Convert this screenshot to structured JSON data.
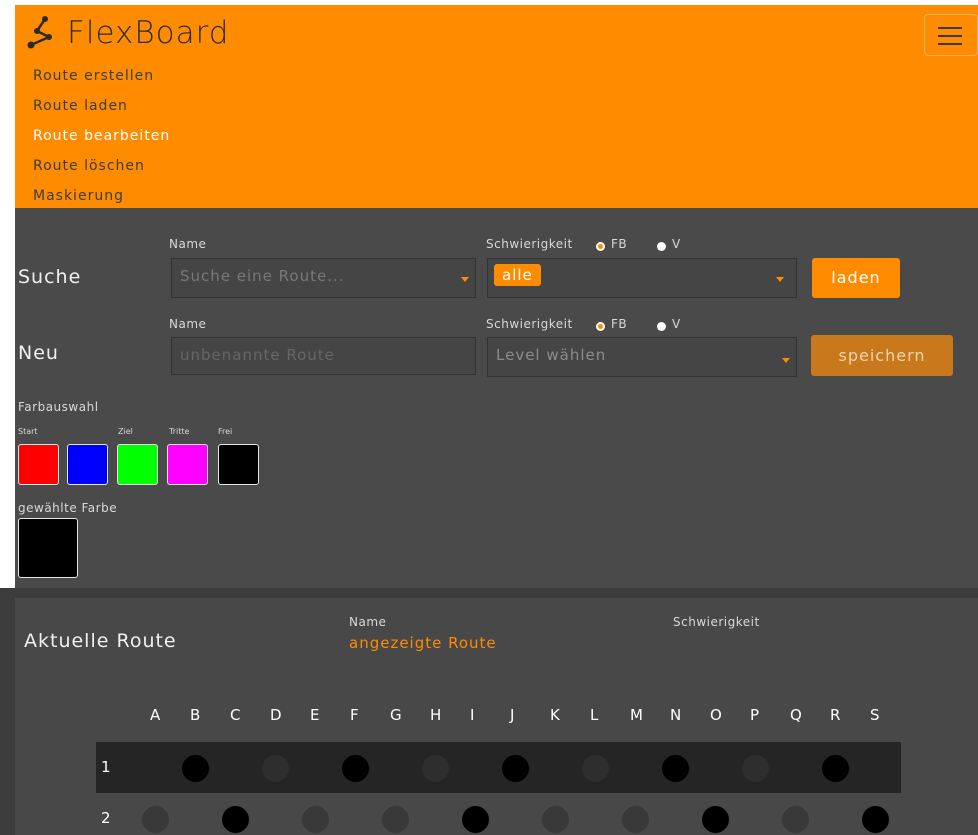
{
  "brand": {
    "title": "FlexBoard"
  },
  "nav": [
    {
      "label": "Route erstellen",
      "active": false
    },
    {
      "label": "Route laden",
      "active": false
    },
    {
      "label": "Route bearbeiten",
      "active": true
    },
    {
      "label": "Route löschen",
      "active": false
    },
    {
      "label": "Maskierung",
      "active": false
    }
  ],
  "search": {
    "section": "Suche",
    "name_label": "Name",
    "name_placeholder": "Suche eine Route...",
    "difficulty_label": "Schwierigkeit",
    "option_fb": "FB",
    "option_v": "V",
    "selected_option": "FB",
    "level_value": "alle",
    "button": "laden"
  },
  "new_route": {
    "section": "Neu",
    "name_label": "Name",
    "name_placeholder": "unbenannte Route",
    "difficulty_label": "Schwierigkeit",
    "option_fb": "FB",
    "option_v": "V",
    "selected_option": "FB",
    "level_placeholder": "Level wählen",
    "button": "speichern"
  },
  "colors": {
    "title": "Farbauswahl",
    "swatches": [
      {
        "label": "Start",
        "color": "#ff0000"
      },
      {
        "label": "",
        "color": "#0000ff"
      },
      {
        "label": "Ziel",
        "color": "#00ff00"
      },
      {
        "label": "Tritte",
        "color": "#ff00ff"
      },
      {
        "label": "Frei",
        "color": "#000000"
      }
    ],
    "selected_label": "gewählte Farbe",
    "selected_color": "#000000",
    "accent": "#ff8c00"
  },
  "current_route": {
    "title": "Aktuelle Route",
    "name_label": "Name",
    "name_value": "angezeigte Route",
    "difficulty_label": "Schwierigkeit"
  },
  "board": {
    "columns": [
      "A",
      "B",
      "C",
      "D",
      "E",
      "F",
      "G",
      "H",
      "I",
      "J",
      "K",
      "L",
      "M",
      "N",
      "O",
      "P",
      "Q",
      "R",
      "S"
    ],
    "rows": [
      {
        "label": "1",
        "holds": [
          {
            "col": "B",
            "state": "filled"
          },
          {
            "col": "D",
            "state": "empty"
          },
          {
            "col": "F",
            "state": "filled"
          },
          {
            "col": "H",
            "state": "empty"
          },
          {
            "col": "J",
            "state": "filled"
          },
          {
            "col": "L",
            "state": "empty"
          },
          {
            "col": "N",
            "state": "filled"
          },
          {
            "col": "P",
            "state": "empty"
          },
          {
            "col": "R",
            "state": "filled"
          }
        ]
      },
      {
        "label": "2",
        "holds": [
          {
            "col": "A",
            "state": "empty"
          },
          {
            "col": "C",
            "state": "filled"
          },
          {
            "col": "E",
            "state": "empty"
          },
          {
            "col": "G",
            "state": "empty"
          },
          {
            "col": "I",
            "state": "filled"
          },
          {
            "col": "K",
            "state": "empty"
          },
          {
            "col": "M",
            "state": "empty"
          },
          {
            "col": "O",
            "state": "filled"
          },
          {
            "col": "Q",
            "state": "empty"
          },
          {
            "col": "S",
            "state": "filled"
          }
        ]
      }
    ]
  }
}
